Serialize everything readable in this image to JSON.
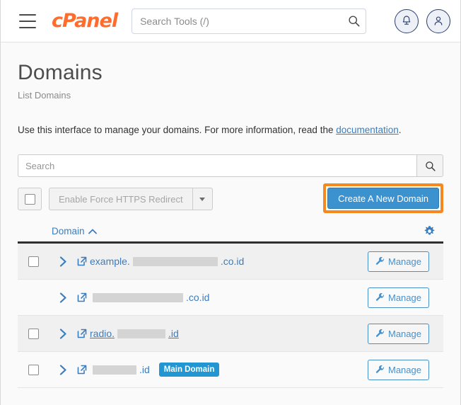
{
  "header": {
    "logo_text": "cPanel",
    "menu_icon": "hamburger-icon",
    "search_placeholder": "Search Tools (/)",
    "search_value": "",
    "search_icon": "search-icon",
    "notifications_icon": "bell-icon",
    "account_icon": "user-icon"
  },
  "page": {
    "title": "Domains",
    "subtitle": "List Domains",
    "intro_text_before": "Use this interface to manage your domains. For more information, read the ",
    "intro_link": "documentation",
    "intro_text_after": "."
  },
  "filter": {
    "search_placeholder": "Search",
    "search_value": "",
    "search_button_icon": "search-icon"
  },
  "toolbar": {
    "select_all_label": "",
    "https_button_label": "Enable Force HTTPS Redirect",
    "https_dropdown_icon": "caret-down-icon",
    "create_label": "Create A New Domain",
    "highlight_color": "#f5881f",
    "create_color": "#3c92cf"
  },
  "table": {
    "column_domain": "Domain",
    "sort_icon": "chevron-up-icon",
    "settings_icon": "gear-icon",
    "manage_label": "Manage",
    "manage_icon": "wrench-icon",
    "expand_icon": "chevron-right-icon",
    "external_link_icon": "external-link-icon",
    "rows": [
      {
        "has_checkbox": true,
        "prefix": "example.",
        "redacted_width": 120,
        "suffix": ".co.id",
        "badge": "",
        "underlined": false,
        "striped": true
      },
      {
        "has_checkbox": false,
        "prefix": "",
        "redacted_width": 128,
        "suffix": ".co.id",
        "badge": "",
        "underlined": false,
        "striped": false
      },
      {
        "has_checkbox": true,
        "prefix": "radio.",
        "redacted_width": 68,
        "suffix": ".id",
        "badge": "",
        "underlined": true,
        "striped": true
      },
      {
        "has_checkbox": true,
        "prefix": "",
        "redacted_width": 62,
        "suffix": ".id",
        "badge": "Main Domain",
        "underlined": false,
        "striped": false
      }
    ]
  }
}
